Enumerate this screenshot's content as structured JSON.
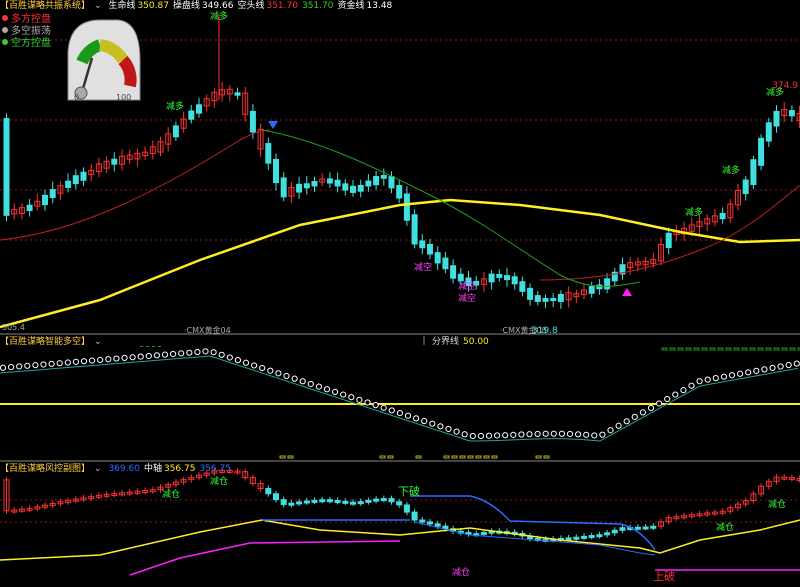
{
  "colors": {
    "up": "#ff3030",
    "down": "#40e0e0",
    "yellow": "#ffee22",
    "green": "#20a020",
    "darkred": "#c02020",
    "blue": "#2a6cff",
    "magenta": "#ff20ff",
    "mag_label": "#ff40ff",
    "green_label": "#30ff30",
    "grid": "#8a1a1a"
  },
  "panel1": {
    "title": "【百胜谋略共振系统】",
    "menu": "⌄",
    "indicators": [
      {
        "label": "生命线",
        "value": "350.87",
        "color": "#ffee22"
      },
      {
        "label": "操盘线",
        "value": "349.66",
        "color": "#ffffff"
      },
      {
        "label": "空头线",
        "value": "351.70",
        "color": "#ff3030"
      },
      {
        "label": "",
        "value": "351.70",
        "color": "#30d030"
      },
      {
        "label": "资金线",
        "value": "13.48",
        "color": "#ffffff"
      }
    ],
    "legend": [
      {
        "text": "多方控盘",
        "color": "#ff3030"
      },
      {
        "text": "多空振荡",
        "color": "#aaaaaa"
      },
      {
        "text": "空方控盘",
        "color": "#30d030"
      }
    ],
    "gauge": {
      "min_label": "0",
      "max_label": "100",
      "value": 12
    },
    "texts": {
      "sell": "减多",
      "buy": "减空",
      "cmx1": "·CMX黄金04",
      "cmx2": "·CMX黄金08",
      "price_top": "374.9",
      "price_bottom": "319.8",
      "left_low": "305.4"
    }
  },
  "panel2": {
    "title": "【百胜谋略智能多空】",
    "menu": "⌄",
    "right_label": "分界线",
    "right_value": "50.00"
  },
  "panel3": {
    "title": "【百胜谋略风控副图】",
    "menu": "⌄",
    "indicators": [
      {
        "label": "",
        "value": "369.60",
        "color": "#2a6cff"
      },
      {
        "label": "中轴",
        "value": "356.75",
        "color": "#ffee22"
      },
      {
        "label": "",
        "value": "356.75",
        "color": "#2a6cff"
      }
    ],
    "texts": {
      "sell": "减仓",
      "buy": "减仓",
      "xiapo": "下破",
      "shangpo": "上破"
    }
  }
}
